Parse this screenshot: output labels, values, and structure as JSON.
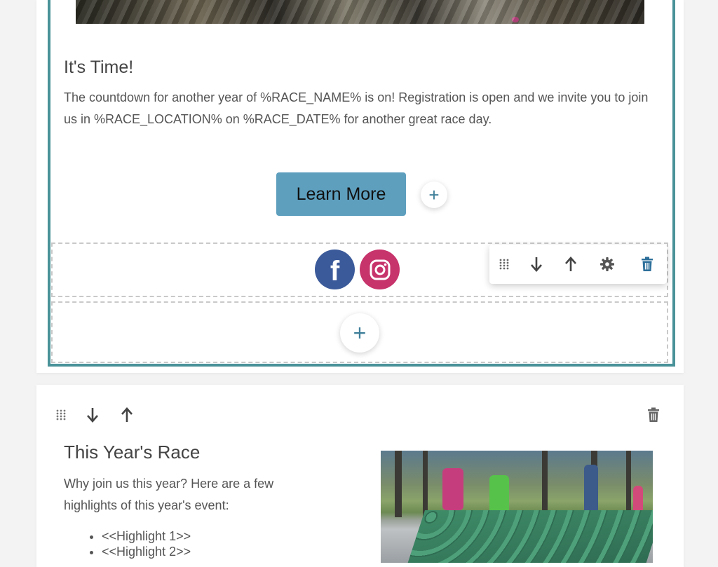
{
  "section_top": {
    "title": "It's Time!",
    "body": "The countdown for another year of %RACE_NAME% is on! Registration is open and we invite you to join us in %RACE_LOCATION% on %RACE_DATE% for another great race day.",
    "button_label": "Learn More",
    "add_symbol": "+",
    "social": [
      {
        "name": "facebook",
        "glyph": "f",
        "color": "#3b5a9a"
      },
      {
        "name": "instagram",
        "color": "#c7336b"
      }
    ],
    "toolbar": {
      "icons": [
        "drag-handle-icon",
        "arrow-down-icon",
        "arrow-up-icon",
        "gear-icon",
        "trash-icon"
      ]
    },
    "accent_border_color": "#4a9299",
    "button_color": "#5e9fbe"
  },
  "section_bottom": {
    "title": "This Year's Race",
    "body": "Why join us this year? Here are a few highlights of this year's event:",
    "highlights": [
      "<<Highlight 1>>",
      "<<Highlight 2>>"
    ],
    "toolbar": {
      "icons": [
        "drag-handle-icon",
        "arrow-down-icon",
        "arrow-up-icon",
        "trash-icon"
      ]
    }
  }
}
